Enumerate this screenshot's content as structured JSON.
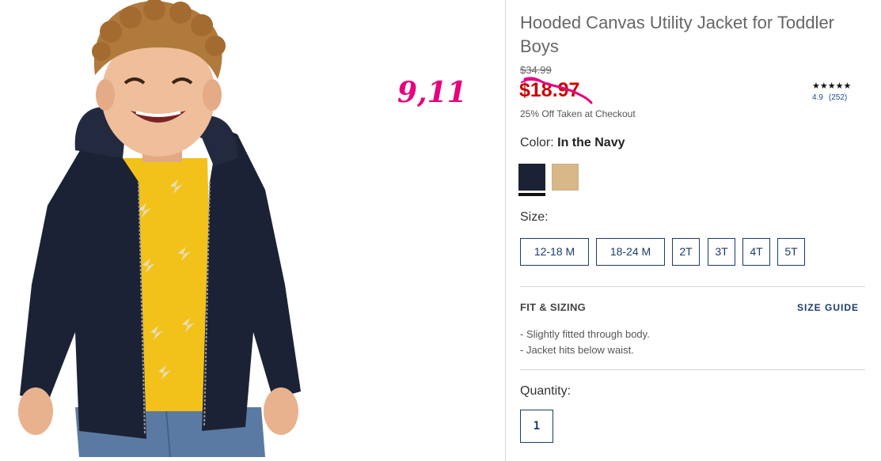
{
  "product": {
    "title": "Hooded Canvas Utility Jacket for Toddler Boys",
    "original_price": "$34.99",
    "sale_price": "$18.97",
    "promo_text": "25% Off Taken at Checkout",
    "rating": {
      "stars": "★★★★★",
      "score": "4.9",
      "count": "(252)"
    },
    "color": {
      "label": "Color:",
      "selected": "In the Navy",
      "swatches": [
        {
          "name": "In the Navy",
          "hex": "#1b2236",
          "selected": true
        },
        {
          "name": "Tan",
          "hex": "#d8b888",
          "selected": false
        }
      ]
    },
    "size": {
      "label": "Size:",
      "options": [
        "12-18 M",
        "18-24 M",
        "2T",
        "3T",
        "4T",
        "5T"
      ]
    },
    "fit": {
      "heading": "FIT & SIZING",
      "size_guide_label": "SIZE GUIDE",
      "bullets": [
        "Slightly fitted through body.",
        "Jacket hits below waist."
      ]
    },
    "quantity": {
      "label": "Quantity:",
      "value": "1"
    }
  },
  "annotation": {
    "text": "9,11",
    "color": "#e6007e"
  },
  "colors": {
    "sale_red": "#cc0000",
    "brand_navy": "#1d3a6b",
    "scribble_pink": "#e6007e"
  }
}
